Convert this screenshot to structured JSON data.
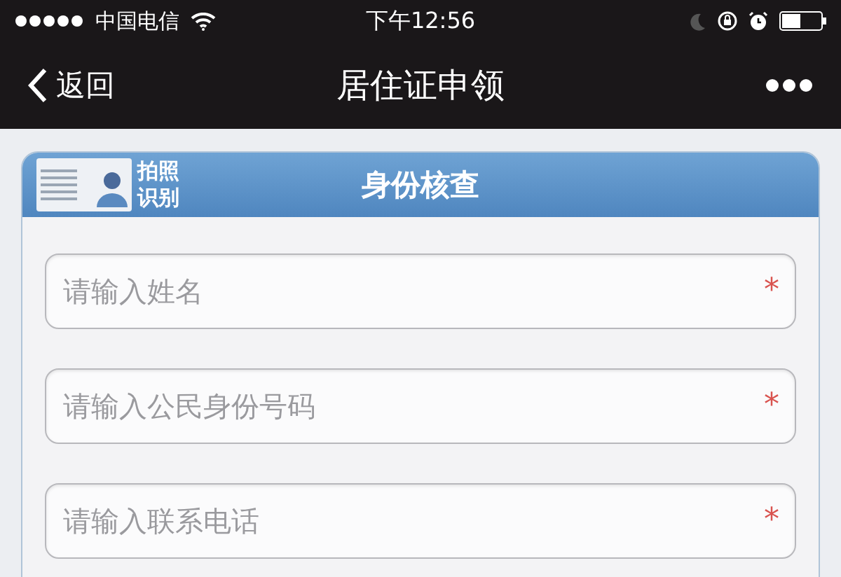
{
  "status_bar": {
    "carrier": "中国电信",
    "time": "下午12:56"
  },
  "nav_bar": {
    "back_label": "返回",
    "title": "居住证申领"
  },
  "card": {
    "photo_button": "拍照识别",
    "title": "身份核查",
    "fields": [
      {
        "placeholder": "请输入姓名",
        "required_mark": "*"
      },
      {
        "placeholder": "请输入公民身份号码",
        "required_mark": "*"
      },
      {
        "placeholder": "请输入联系电话",
        "required_mark": "*"
      }
    ]
  }
}
